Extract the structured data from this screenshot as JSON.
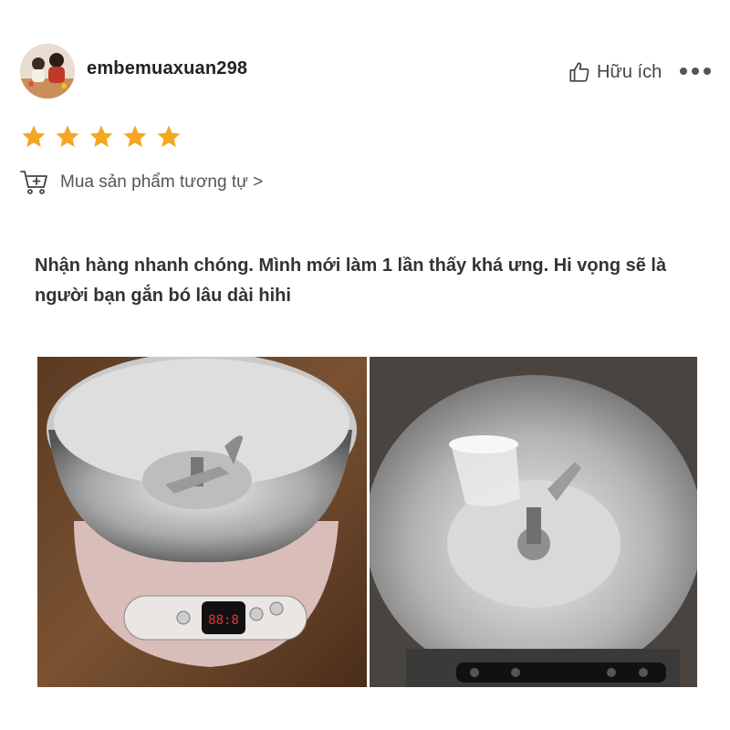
{
  "review": {
    "username": "embemuaxuan298",
    "helpful_label": "Hữu ích",
    "rating": 5,
    "max_rating": 5,
    "buy_similar_label": "Mua sản phẩm tương tự >",
    "text": "Nhận hàng nhanh chóng. Mình mới làm 1 lần thấy khá ưng. Hi vọng sẽ là người bạn gắn bó lâu dài hihi"
  },
  "colors": {
    "star": "#f5a623",
    "text": "#333333"
  },
  "icons": {
    "helpful": "thumbs-up-icon",
    "more": "more-options-icon",
    "cart": "cart-plus-icon",
    "star": "star-icon"
  },
  "photos": [
    {
      "name": "review-photo-1"
    },
    {
      "name": "review-photo-2"
    }
  ]
}
